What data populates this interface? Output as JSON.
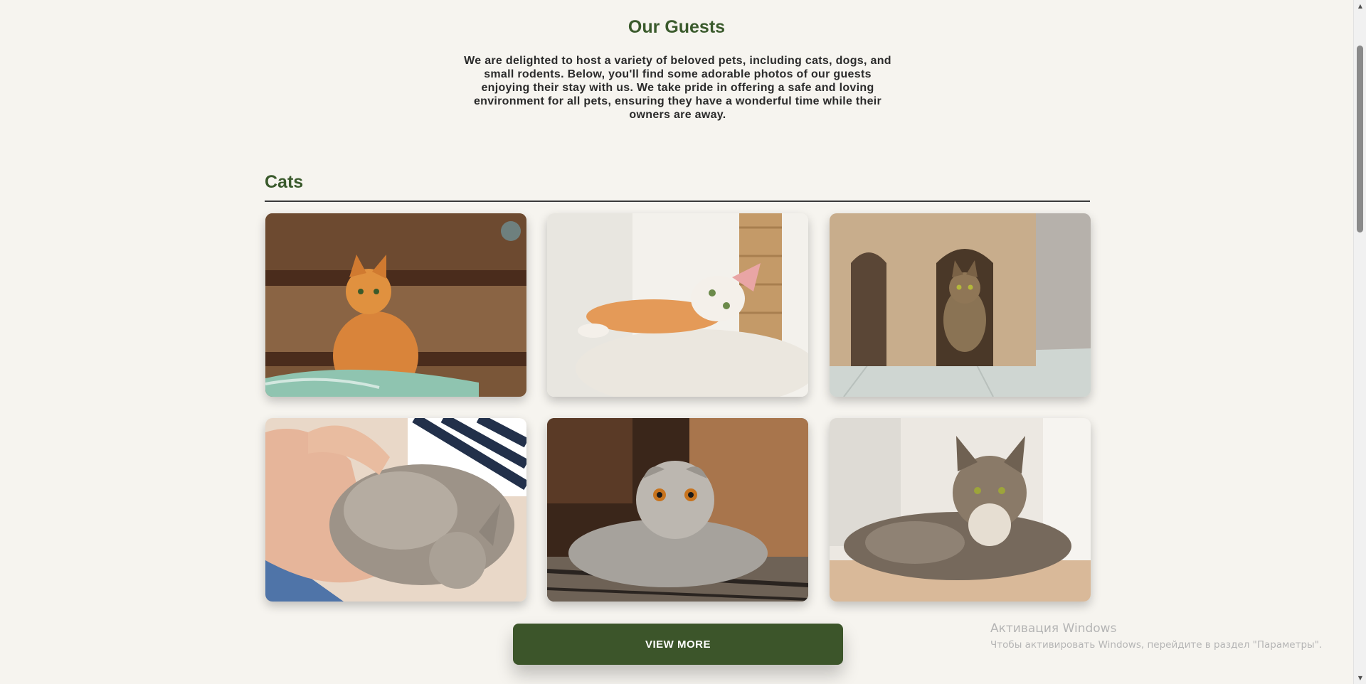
{
  "header": {
    "title": "Our Guests",
    "intro": "We are delighted to host a variety of beloved pets, including cats, dogs, and small rodents. Below, you'll find some adorable photos of our guests enjoying their stay with us. We take pride in offering a safe and loving environment for all pets, ensuring they have a wonderful time while their owners are away."
  },
  "section": {
    "title": "Cats"
  },
  "gallery": {
    "images": [
      {
        "subject": "ginger cat sitting by wooden chest"
      },
      {
        "subject": "ginger and white cat lying on cat tree"
      },
      {
        "subject": "tabby cat inside cat house"
      },
      {
        "subject": "grey tabby cat being petted in arms"
      },
      {
        "subject": "grey scottish fold cat lying on rug"
      },
      {
        "subject": "long-haired tabby cat lying on floor"
      }
    ]
  },
  "actions": {
    "view_more_label": "VIEW MORE"
  },
  "watermark": {
    "title": "Активация Windows",
    "subtitle": "Чтобы активировать Windows, перейдите в раздел \"Параметры\"."
  },
  "colors": {
    "background": "#f6f4ef",
    "accent": "#3a5a2c",
    "button": "#3c552a"
  }
}
